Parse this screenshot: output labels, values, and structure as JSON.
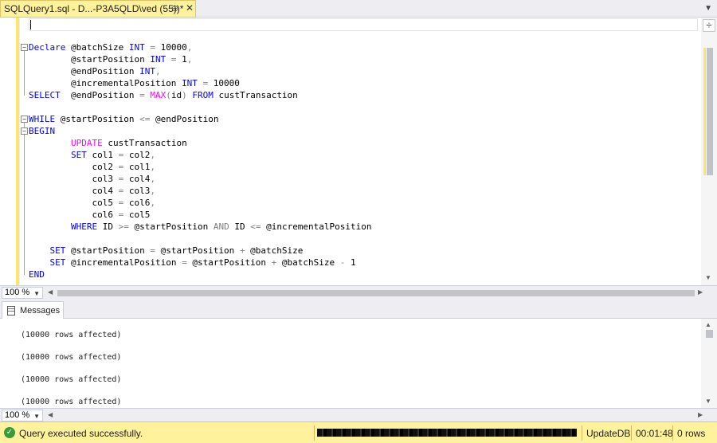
{
  "tab": {
    "title": "SQLQuery1.sql - D...-P3A5QLD\\ved (55))*",
    "pin_icon": "pin-icon",
    "close_icon": "close-icon"
  },
  "editor": {
    "lines": [
      {
        "fold": "⊟",
        "segments": [
          {
            "t": "kw",
            "v": "Declare"
          },
          {
            "t": "txt",
            "v": " @batchSize "
          },
          {
            "t": "kw",
            "v": "INT"
          },
          {
            "t": "txt",
            "v": " "
          },
          {
            "t": "op",
            "v": "="
          },
          {
            "t": "txt",
            "v": " 10000"
          },
          {
            "t": "op",
            "v": ","
          }
        ]
      },
      {
        "segments": [
          {
            "t": "txt",
            "v": "        @startPosition "
          },
          {
            "t": "kw",
            "v": "INT"
          },
          {
            "t": "txt",
            "v": " "
          },
          {
            "t": "op",
            "v": "="
          },
          {
            "t": "txt",
            "v": " 1"
          },
          {
            "t": "op",
            "v": ","
          }
        ]
      },
      {
        "segments": [
          {
            "t": "txt",
            "v": "        @endPosition "
          },
          {
            "t": "kw",
            "v": "INT"
          },
          {
            "t": "op",
            "v": ","
          }
        ]
      },
      {
        "segments": [
          {
            "t": "txt",
            "v": "        @incrementalPosition "
          },
          {
            "t": "kw",
            "v": "INT"
          },
          {
            "t": "txt",
            "v": " "
          },
          {
            "t": "op",
            "v": "="
          },
          {
            "t": "txt",
            "v": " 10000"
          }
        ]
      },
      {
        "segments": [
          {
            "t": "kw",
            "v": "SELECT"
          },
          {
            "t": "txt",
            "v": "  @endPosition "
          },
          {
            "t": "op",
            "v": "="
          },
          {
            "t": "txt",
            "v": " "
          },
          {
            "t": "fn",
            "v": "MAX"
          },
          {
            "t": "op",
            "v": "("
          },
          {
            "t": "txt",
            "v": "id"
          },
          {
            "t": "op",
            "v": ")"
          },
          {
            "t": "txt",
            "v": " "
          },
          {
            "t": "kw",
            "v": "FROM"
          },
          {
            "t": "txt",
            "v": " custTransaction"
          }
        ]
      },
      {
        "segments": []
      },
      {
        "fold": "⊟",
        "segments": [
          {
            "t": "kw",
            "v": "WHILE"
          },
          {
            "t": "txt",
            "v": " @startPosition "
          },
          {
            "t": "op",
            "v": "<="
          },
          {
            "t": "txt",
            "v": " @endPosition"
          }
        ]
      },
      {
        "fold": "⊟",
        "segments": [
          {
            "t": "kw",
            "v": "BEGIN"
          }
        ]
      },
      {
        "segments": [
          {
            "t": "txt",
            "v": "        "
          },
          {
            "t": "fn",
            "v": "UPDATE"
          },
          {
            "t": "txt",
            "v": " custTransaction"
          }
        ]
      },
      {
        "segments": [
          {
            "t": "txt",
            "v": "        "
          },
          {
            "t": "kw",
            "v": "SET"
          },
          {
            "t": "txt",
            "v": " col1 "
          },
          {
            "t": "op",
            "v": "="
          },
          {
            "t": "txt",
            "v": " col2"
          },
          {
            "t": "op",
            "v": ","
          }
        ]
      },
      {
        "segments": [
          {
            "t": "txt",
            "v": "            col2 "
          },
          {
            "t": "op",
            "v": "="
          },
          {
            "t": "txt",
            "v": " col1"
          },
          {
            "t": "op",
            "v": ","
          }
        ]
      },
      {
        "segments": [
          {
            "t": "txt",
            "v": "            col3 "
          },
          {
            "t": "op",
            "v": "="
          },
          {
            "t": "txt",
            "v": " col4"
          },
          {
            "t": "op",
            "v": ","
          }
        ]
      },
      {
        "segments": [
          {
            "t": "txt",
            "v": "            col4 "
          },
          {
            "t": "op",
            "v": "="
          },
          {
            "t": "txt",
            "v": " col3"
          },
          {
            "t": "op",
            "v": ","
          }
        ]
      },
      {
        "segments": [
          {
            "t": "txt",
            "v": "            col5 "
          },
          {
            "t": "op",
            "v": "="
          },
          {
            "t": "txt",
            "v": " col6"
          },
          {
            "t": "op",
            "v": ","
          }
        ]
      },
      {
        "segments": [
          {
            "t": "txt",
            "v": "            col6 "
          },
          {
            "t": "op",
            "v": "="
          },
          {
            "t": "txt",
            "v": " col5"
          }
        ]
      },
      {
        "segments": [
          {
            "t": "txt",
            "v": "        "
          },
          {
            "t": "kw",
            "v": "WHERE"
          },
          {
            "t": "txt",
            "v": " ID "
          },
          {
            "t": "op",
            "v": ">="
          },
          {
            "t": "txt",
            "v": " @startPosition "
          },
          {
            "t": "op",
            "v": "AND"
          },
          {
            "t": "txt",
            "v": " ID "
          },
          {
            "t": "op",
            "v": "<="
          },
          {
            "t": "txt",
            "v": " @incrementalPosition"
          }
        ]
      },
      {
        "segments": []
      },
      {
        "segments": [
          {
            "t": "txt",
            "v": "    "
          },
          {
            "t": "kw",
            "v": "SET"
          },
          {
            "t": "txt",
            "v": " @startPosition "
          },
          {
            "t": "op",
            "v": "="
          },
          {
            "t": "txt",
            "v": " @startPosition "
          },
          {
            "t": "op",
            "v": "+"
          },
          {
            "t": "txt",
            "v": " @batchSize"
          }
        ]
      },
      {
        "segments": [
          {
            "t": "txt",
            "v": "    "
          },
          {
            "t": "kw",
            "v": "SET"
          },
          {
            "t": "txt",
            "v": " @incrementalPosition "
          },
          {
            "t": "op",
            "v": "="
          },
          {
            "t": "txt",
            "v": " @startPosition "
          },
          {
            "t": "op",
            "v": "+"
          },
          {
            "t": "txt",
            "v": " @batchSize "
          },
          {
            "t": "op",
            "v": "-"
          },
          {
            "t": "txt",
            "v": " 1"
          }
        ]
      },
      {
        "segments": [
          {
            "t": "kw",
            "v": "END"
          }
        ]
      }
    ]
  },
  "editor_zoom": "100 %",
  "results": {
    "tab_label": "Messages",
    "messages": [
      "(10000 rows affected)",
      "(10000 rows affected)",
      "(10000 rows affected)",
      "(10000 rows affected)"
    ],
    "zoom": "100 %"
  },
  "status": {
    "text": "Query executed successfully.",
    "database": "UpdateDB",
    "elapsed": "00:01:48",
    "rows": "0 rows"
  },
  "colors": {
    "keyword": "#0000ff",
    "function": "#ff00ff",
    "operator": "#808080",
    "status_bar": "#fff29d"
  }
}
